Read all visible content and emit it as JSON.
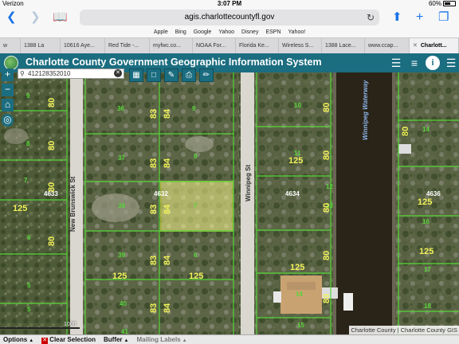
{
  "status_bar": {
    "carrier": "Verizon",
    "time": "3:07 PM",
    "battery": "60%",
    "battery_level": 0.6
  },
  "browser": {
    "url": "agis.charlottecountyfl.gov",
    "favorites": [
      "Apple",
      "Bing",
      "Google",
      "Yahoo",
      "Disney",
      "ESPN",
      "Yahoo!"
    ],
    "tabs": [
      "w",
      "1388 La",
      "10616 Aye...",
      "Red Tide -...",
      "myfwc.co...",
      "NOAA For...",
      "Florida Ke...",
      "Wireless S...",
      "1388 Lace...",
      "www.ccap...",
      "Charlott..."
    ],
    "active_tab_index": 10
  },
  "app": {
    "title": "Charlotte County Government Geographic Information System",
    "search_value": "412128352010"
  },
  "map": {
    "streets": [
      "New Brunswick St",
      "Winnipeg St"
    ],
    "waterway": "Winnipeg Waterway",
    "lot_numbers": [
      "9",
      "36",
      "9",
      "10",
      "8",
      "37",
      "8",
      "11",
      "14",
      "7",
      "12",
      "38",
      "7",
      "13",
      "6",
      "39",
      "6",
      "5",
      "40",
      "14",
      "5",
      "15",
      "41",
      "16",
      "17",
      "18"
    ],
    "block_numbers": [
      "4633",
      "4632",
      "4634",
      "4636"
    ],
    "dimensions": [
      "80",
      "80",
      "80",
      "80",
      "83",
      "84",
      "83",
      "84",
      "83",
      "84",
      "83",
      "84",
      "83",
      "84",
      "125",
      "125",
      "125",
      "125",
      "125",
      "125",
      "125",
      "80",
      "80",
      "80",
      "80",
      "80",
      "80"
    ],
    "scale_label": "100ft",
    "attribution": "Charlotte County | Charlotte County GIS"
  },
  "bottom_bar": {
    "options": "Options",
    "clear": "Clear Selection",
    "buffer": "Buffer",
    "mailing": "Mailing Labels"
  },
  "colors": {
    "header": "#1b6d80",
    "parcel_line": "#58d63a",
    "dimension_text": "#f2f25a",
    "selected_parcel": "#f5f58a",
    "waterway": "#2a2418"
  }
}
